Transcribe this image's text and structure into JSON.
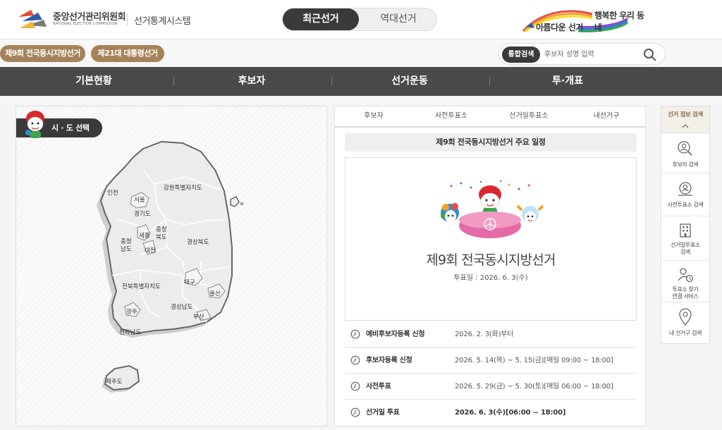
{
  "header": {
    "org_name": "중앙선거관리위원회",
    "org_name_en": "NATIONAL ELECTION COMMISSION",
    "system_name": "선거통계시스템",
    "toggle": {
      "active": "최근선거",
      "inactive": "역대선거"
    },
    "slogan_top": "행복한 우리 동네",
    "slogan_bottom": "아름다운 선거"
  },
  "subbar": {
    "elections": [
      "제9회 전국동시지방선거",
      "제21대 대통령선거"
    ],
    "search_label": "통합검색",
    "search_placeholder": "후보자 성명 입력"
  },
  "nav": {
    "items": [
      "기본현황",
      "후보자",
      "선거운동",
      "투·개표"
    ]
  },
  "map": {
    "pill_label": "시 · 도 선택",
    "regions": {
      "incheon": "인천",
      "seoul": "서울",
      "gyeonggi": "경기도",
      "gangwon": "강원특별자치도",
      "chungnam_1": "충청",
      "chungnam_2": "남도",
      "sejong": "세종",
      "daejeon": "대전",
      "chungbuk_1": "충청",
      "chungbuk_2": "북도",
      "gyeongbuk": "경상북도",
      "daegu": "대구",
      "jeonbuk": "전북특별자치도",
      "ulsan": "울산",
      "gwangju": "광주",
      "gyeongnam": "경상남도",
      "busan": "부산",
      "jeonnam": "전라남도",
      "jeju": "제주도"
    }
  },
  "info": {
    "tabs": [
      "후보자",
      "사전투표소",
      "선거일투표소",
      "내선거구"
    ],
    "schedule_title": "제9회 전국동시지방선거 주요 일정",
    "hero_title": "제9회 전국동시지방선거",
    "hero_date": "투표일 : 2026. 6. 3(수)",
    "schedule": [
      {
        "name": "예비후보자등록 신청",
        "date": "2026. 2. 3(화)부터"
      },
      {
        "name": "후보자등록 신청",
        "date": "2026. 5. 14(목) ~ 5. 15(금)[매일 09:00 ~ 18:00]"
      },
      {
        "name": "사전투표",
        "date": "2026. 5. 29(금) ~ 5. 30(토)[매일 06:00 ~ 18:00]"
      },
      {
        "name": "선거일 투표",
        "date": "2026. 6. 3(수)[06:00 ~ 18:00]"
      }
    ]
  },
  "quick_menu": {
    "title": "선거 정보 검색",
    "items": [
      {
        "label_1": "후보자 검색",
        "label_2": "",
        "icon": "person-search-icon"
      },
      {
        "label_1": "사전투표소 검색",
        "label_2": "",
        "icon": "polling-place-icon"
      },
      {
        "label_1": "선거일투표소",
        "label_2": "검색",
        "icon": "building-icon"
      },
      {
        "label_1": "투표소 찾기",
        "label_2": "연결 서비스",
        "icon": "person-location-icon"
      },
      {
        "label_1": "내 선거구 검색",
        "label_2": "",
        "icon": "map-pin-icon"
      }
    ]
  },
  "colors": {
    "accent_brown": "#a5835a",
    "nav_dark": "#4a4a4a",
    "pill_dark": "#3a3a3a"
  }
}
